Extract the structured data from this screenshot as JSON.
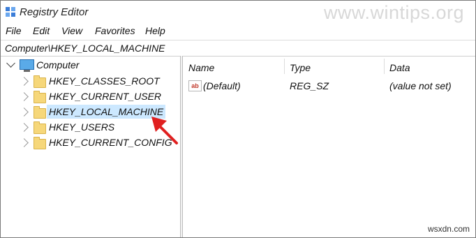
{
  "window": {
    "title": "Registry Editor",
    "watermark": "www.wintips.org"
  },
  "menu": [
    "File",
    "Edit",
    "View",
    "Favorites",
    "Help"
  ],
  "address": "Computer\\HKEY_LOCAL_MACHINE",
  "tree": {
    "root": "Computer",
    "items": [
      "HKEY_CLASSES_ROOT",
      "HKEY_CURRENT_USER",
      "HKEY_LOCAL_MACHINE",
      "HKEY_USERS",
      "HKEY_CURRENT_CONFIG"
    ],
    "selected": "HKEY_LOCAL_MACHINE"
  },
  "list": {
    "columns": [
      "Name",
      "Type",
      "Data"
    ],
    "rows": [
      {
        "name": "(Default)",
        "type": "REG_SZ",
        "data": "(value not set)"
      }
    ]
  },
  "footer": "wsxdn.com",
  "colors": {
    "selection": "#cce8ff",
    "folder": "#f6d77a",
    "arrow": "#e02020"
  }
}
